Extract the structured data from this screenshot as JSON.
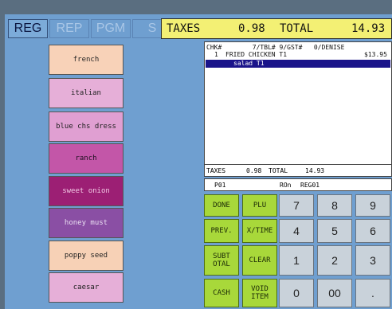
{
  "mode_tabs": [
    {
      "label": "REG",
      "active": true
    },
    {
      "label": "REP",
      "active": false
    },
    {
      "label": "PGM",
      "active": false
    },
    {
      "label": "S",
      "active": false
    }
  ],
  "top_bar": {
    "taxes_label": "TAXES",
    "taxes_value": "0.98",
    "total_label": "TOTAL",
    "total_value": "14.93"
  },
  "receipt": {
    "header": "CHK#        7/TBL# 9/GST#   0/DENISE",
    "item_qty": "1",
    "item_name": "FRIED CHICKEN T1",
    "item_price": "$13.95",
    "selected_line": "salad T1"
  },
  "totals_line": {
    "taxes_label": "TAXES",
    "taxes_value": "0.98",
    "total_label": "TOTAL",
    "total_value": "14.93"
  },
  "status_line": {
    "code": "P01",
    "ron": "ROn",
    "register": "REG01"
  },
  "modifiers": [
    {
      "label": "french",
      "color": "#f8d2b8",
      "text_color": "#222222"
    },
    {
      "label": "italian",
      "color": "#e6afd8",
      "text_color": "#222222"
    },
    {
      "label": "blue chs dress",
      "color": "#e09fd2",
      "text_color": "#222222"
    },
    {
      "label": "ranch",
      "color": "#c356a8",
      "text_color": "#1e1020"
    },
    {
      "label": "sweet onion",
      "color": "#9c1f74",
      "text_color": "#f2c8e4"
    },
    {
      "label": "honey must",
      "color": "#8a4fa4",
      "text_color": "#eadff2"
    },
    {
      "label": "poppy seed",
      "color": "#f7d1b6",
      "text_color": "#222222"
    },
    {
      "label": "caesar",
      "color": "#e6afd8",
      "text_color": "#222222"
    }
  ],
  "function_keys": [
    {
      "label": "DONE"
    },
    {
      "label": "PLU"
    },
    {
      "label": "PREV."
    },
    {
      "label": "X/TIME"
    },
    {
      "label": "SUBT OTAL"
    },
    {
      "label": "CLEAR"
    },
    {
      "label": "CASH"
    },
    {
      "label": "VOID ITEM"
    }
  ],
  "number_keys": [
    "7",
    "8",
    "9",
    "4",
    "5",
    "6",
    "1",
    "2",
    "3",
    "0",
    "00",
    "."
  ],
  "colors": {
    "screen_bg": "#6f9fd0",
    "top_bar": "#f3f074",
    "function_key": "#a8d83a",
    "number_key": "#c9d2da",
    "selected_line": "#1a148a"
  }
}
